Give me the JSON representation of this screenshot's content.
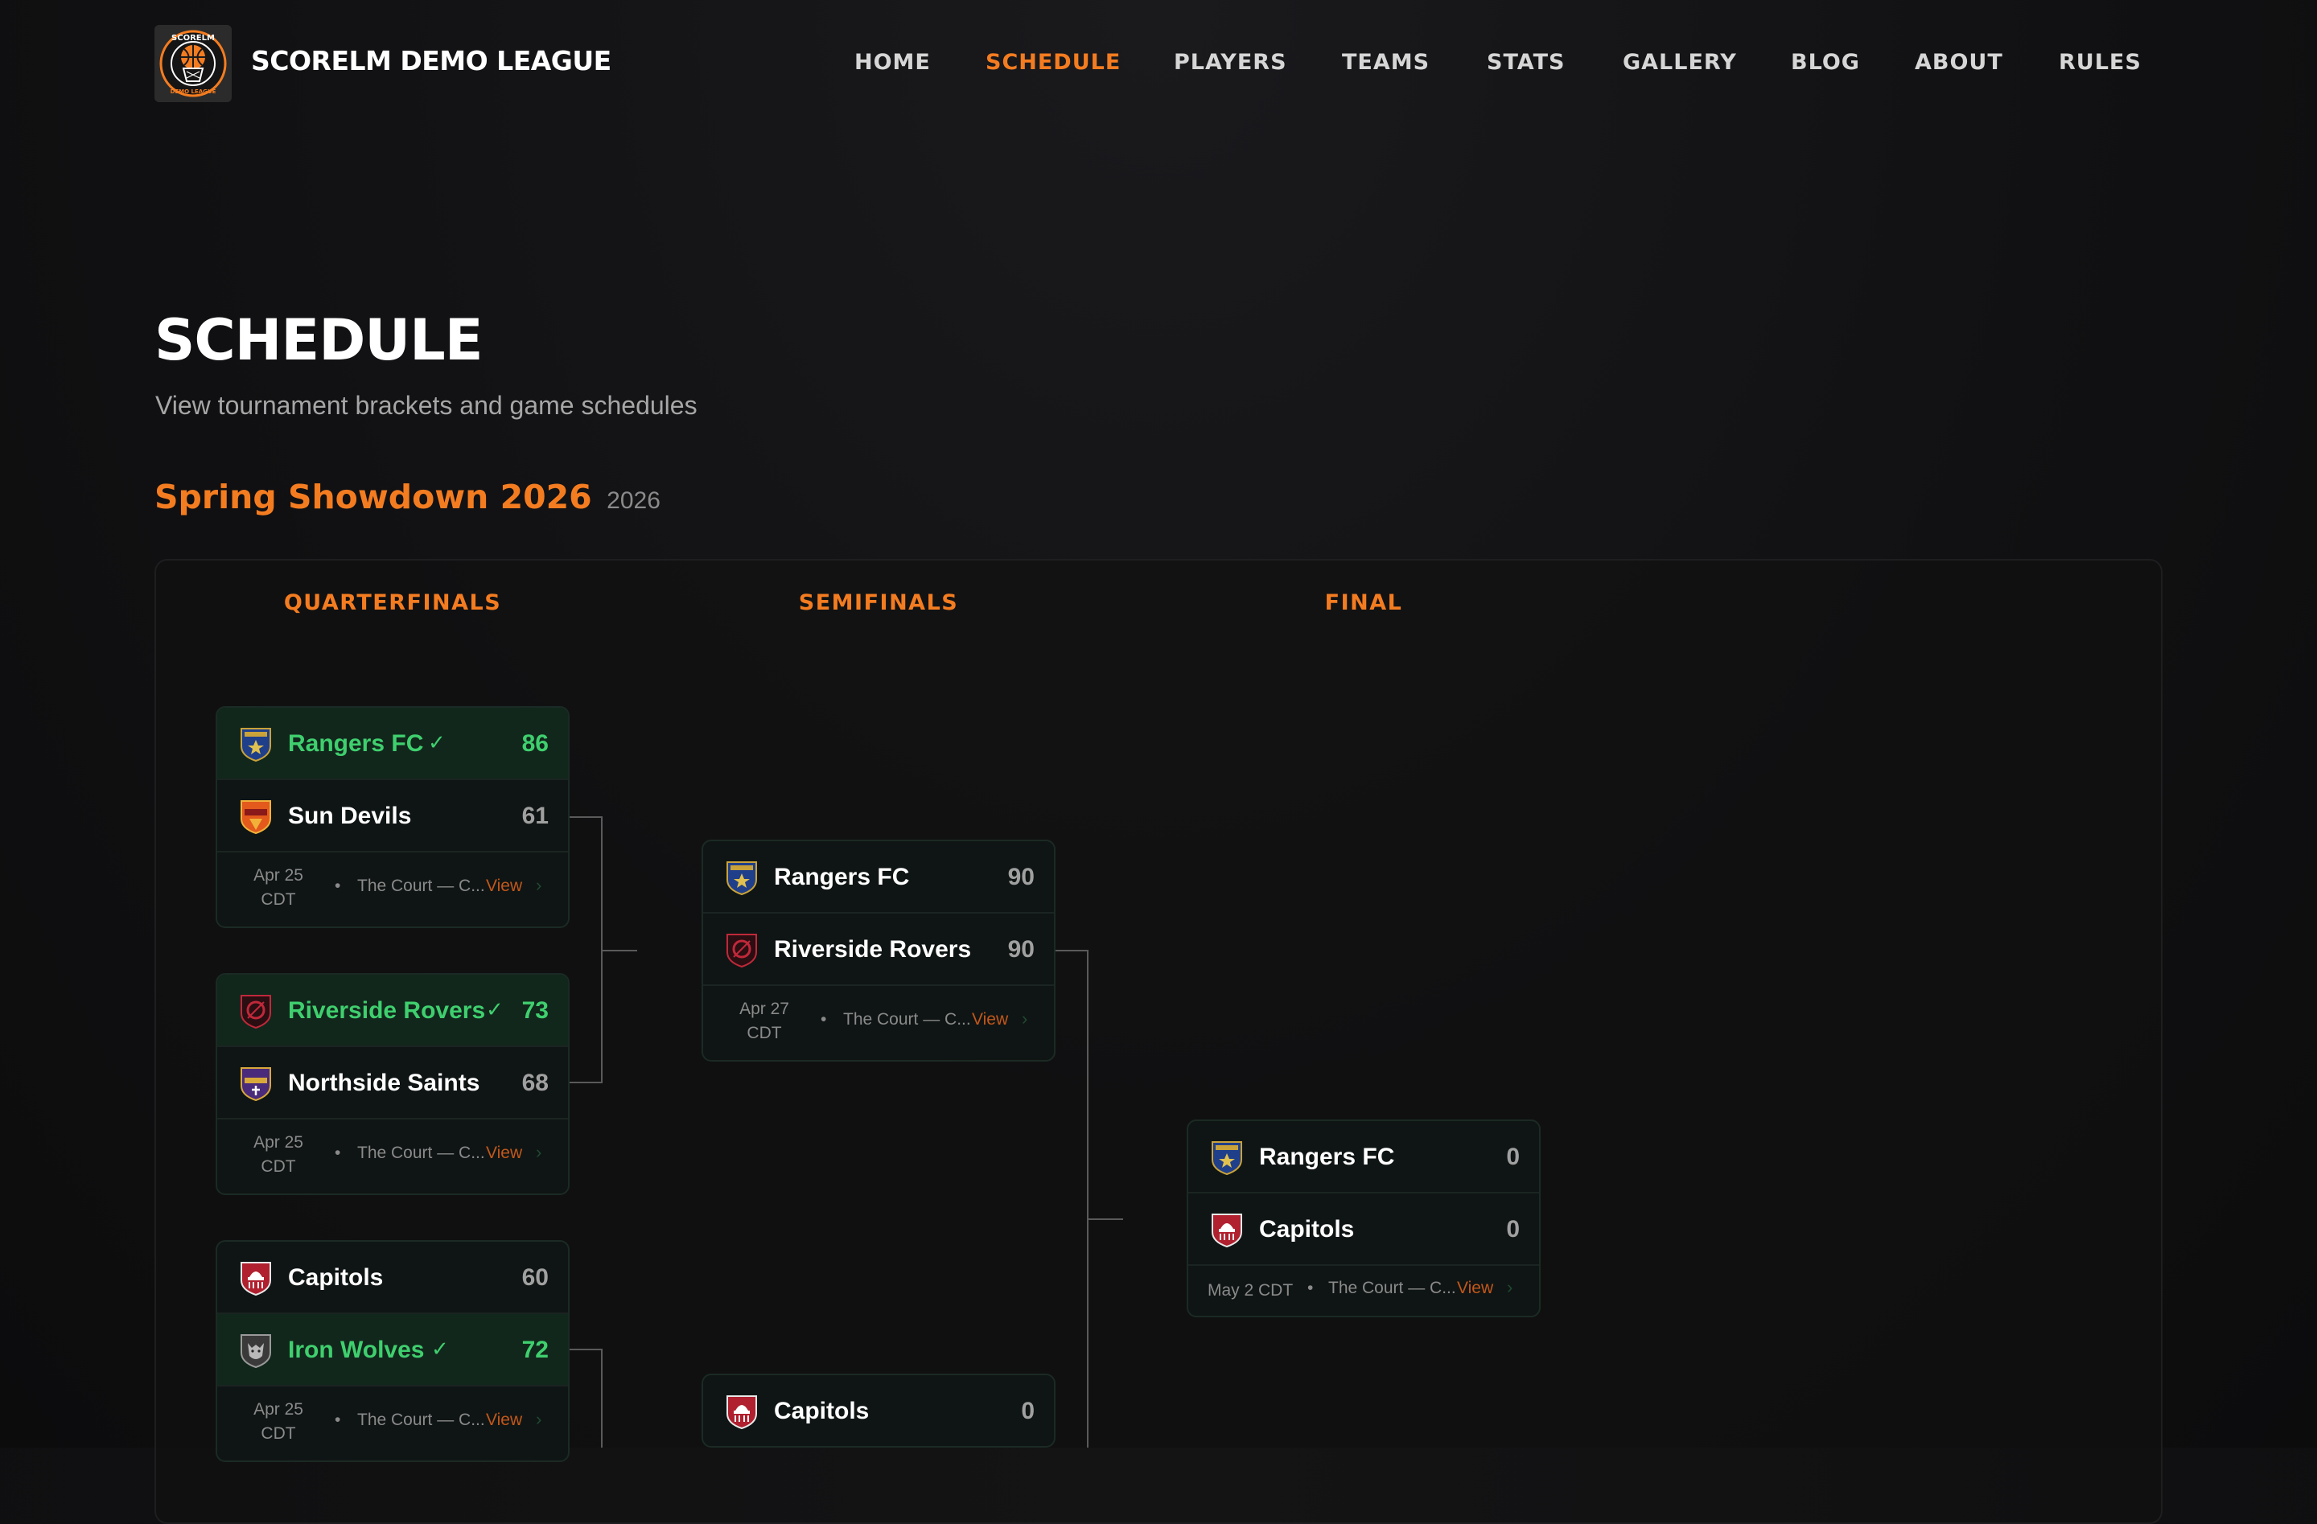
{
  "brand": {
    "name": "SCORELM DEMO LEAGUE",
    "logo_top": "SCORELM",
    "logo_bottom": "DEMO LEAGUE"
  },
  "nav": [
    {
      "label": "HOME",
      "active": false
    },
    {
      "label": "SCHEDULE",
      "active": true
    },
    {
      "label": "PLAYERS",
      "active": false
    },
    {
      "label": "TEAMS",
      "active": false
    },
    {
      "label": "STATS",
      "active": false
    },
    {
      "label": "GALLERY",
      "active": false
    },
    {
      "label": "BLOG",
      "active": false
    },
    {
      "label": "ABOUT",
      "active": false
    },
    {
      "label": "RULES",
      "active": false
    }
  ],
  "page": {
    "title": "SCHEDULE",
    "subtitle": "View tournament brackets and game schedules"
  },
  "tournament": {
    "name": "Spring Showdown 2026",
    "year": "2026"
  },
  "rounds": {
    "quarterfinals": "QUARTERFINALS",
    "semifinals": "SEMIFINALS",
    "final": "FINAL"
  },
  "matches": {
    "qf1": {
      "home": {
        "name": "Rangers FC",
        "score": "86",
        "winner": true,
        "crest": "rangers-crest"
      },
      "away": {
        "name": "Sun Devils",
        "score": "61",
        "winner": false,
        "crest": "sundevils-crest"
      },
      "date_line1": "Apr 25",
      "date_line2": "CDT",
      "venue": "The Court — C...",
      "view": "View"
    },
    "qf2": {
      "home": {
        "name": "Riverside Rovers",
        "score": "73",
        "winner": true,
        "crest": "rovers-crest"
      },
      "away": {
        "name": "Northside Saints",
        "score": "68",
        "winner": false,
        "crest": "saints-crest"
      },
      "date_line1": "Apr 25",
      "date_line2": "CDT",
      "venue": "The Court — C...",
      "view": "View"
    },
    "qf3": {
      "home": {
        "name": "Capitols",
        "score": "60",
        "winner": false,
        "crest": "capitols-crest"
      },
      "away": {
        "name": "Iron Wolves",
        "score": "72",
        "winner": true,
        "crest": "wolves-crest"
      },
      "date_line1": "Apr 25",
      "date_line2": "CDT",
      "venue": "The Court — C...",
      "view": "View"
    },
    "sf1": {
      "home": {
        "name": "Rangers FC",
        "score": "90",
        "winner": false,
        "crest": "rangers-crest"
      },
      "away": {
        "name": "Riverside Rovers",
        "score": "90",
        "winner": false,
        "crest": "rovers-crest"
      },
      "date_line1": "Apr 27",
      "date_line2": "CDT",
      "venue": "The Court — C...",
      "view": "View"
    },
    "sf2": {
      "home": {
        "name": "Capitols",
        "score": "0",
        "winner": false,
        "crest": "capitols-crest"
      }
    },
    "final": {
      "home": {
        "name": "Rangers FC",
        "score": "0",
        "winner": false,
        "crest": "rangers-crest"
      },
      "away": {
        "name": "Capitols",
        "score": "0",
        "winner": false,
        "crest": "capitols-crest"
      },
      "date": "May 2 CDT",
      "venue": "The Court — C...",
      "view": "View"
    }
  },
  "colors": {
    "accent": "#f47c20",
    "winner": "#3fcf6e",
    "winner_bg": "#12271c",
    "card_bg": "#0f1514"
  },
  "check_glyph": "✓",
  "chevron_glyph": "›",
  "dot_glyph": "•"
}
